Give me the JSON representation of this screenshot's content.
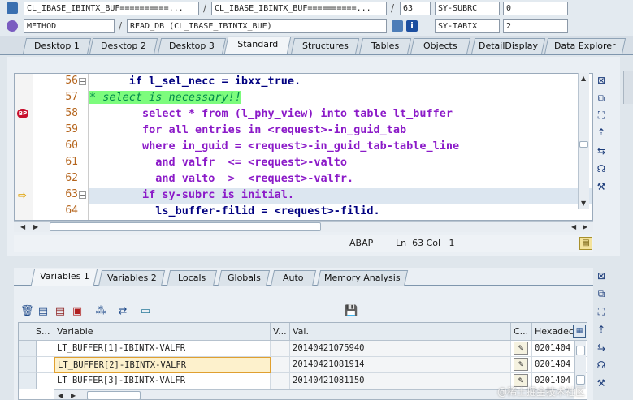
{
  "header": {
    "row1": {
      "program1": "CL_IBASE_IBINTX_BUF==========...",
      "program2": "CL_IBASE_IBINTX_BUF==========...",
      "line": "63",
      "sysvar": "SY-SUBRC",
      "sysval": "0"
    },
    "row2": {
      "event_type": "METHOD",
      "event_name": "READ_DB (CL_IBASE_IBINTX_BUF)",
      "sysvar": "SY-TABIX",
      "sysval": "2"
    }
  },
  "tabs": [
    "Desktop 1",
    "Desktop 2",
    "Desktop 3",
    "Standard",
    "Structures",
    "Tables",
    "Objects",
    "DetailDisplay",
    "Data Explorer"
  ],
  "active_tab": "Standard",
  "editor": {
    "lines": [
      {
        "num": "56",
        "text": "      if l_sel_necc = ibxx_true."
      },
      {
        "num": "57",
        "text": "* select is necessary!!"
      },
      {
        "num": "58",
        "text": "        select * from (l_phy_view) into table lt_buffer"
      },
      {
        "num": "59",
        "text": "        for all entries in <request>-in_guid_tab"
      },
      {
        "num": "60",
        "text": "        where in_guid = <request>-in_guid_tab-table_line"
      },
      {
        "num": "61",
        "text": "          and valfr  <= <request>-valto"
      },
      {
        "num": "62",
        "text": "          and valto  >  <request>-valfr."
      },
      {
        "num": "63",
        "text": "        if sy-subrc is initial."
      },
      {
        "num": "64",
        "text": "          ls_buffer-filid = <request>-filid."
      }
    ],
    "current_line": "63"
  },
  "status": {
    "lang": "ABAP",
    "position": "Ln  63 Col   1"
  },
  "var_tabs": [
    "Variables 1",
    "Variables 2",
    "Locals",
    "Globals",
    "Auto",
    "Memory Analysis"
  ],
  "active_var_tab": "Variables 1",
  "grid": {
    "headers": [
      "S...",
      "Variable",
      "V...",
      "Val.",
      "C...",
      "Hexadec"
    ],
    "rows": [
      {
        "variable": "LT_BUFFER[1]-IBINTX-VALFR",
        "value": "20140421075940",
        "hex": "0201404"
      },
      {
        "variable": "LT_BUFFER[2]-IBINTX-VALFR",
        "value": "20140421081914",
        "hex": "0201404"
      },
      {
        "variable": "LT_BUFFER[3]-IBINTX-VALFR",
        "value": "20140421081150",
        "hex": "0201404"
      }
    ]
  },
  "watermark": "@稀土掘金技术社区"
}
